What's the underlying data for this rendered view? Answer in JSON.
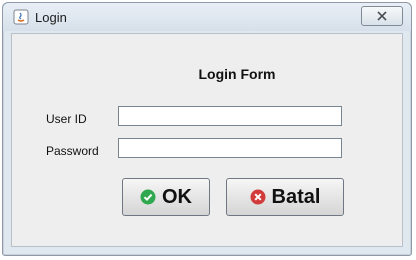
{
  "window": {
    "title": "Login",
    "colors": {
      "chrome": "#dfe7ef",
      "panel": "#eeeeee"
    }
  },
  "form": {
    "title": "Login Form",
    "fields": [
      {
        "label": "User ID",
        "value": ""
      },
      {
        "label": "Password",
        "value": ""
      }
    ]
  },
  "buttons": {
    "ok": {
      "label": "OK",
      "icon": "check-circle-icon",
      "color": "#2fa84f"
    },
    "cancel": {
      "label": "Batal",
      "icon": "x-circle-icon",
      "color": "#d23b3b"
    }
  }
}
